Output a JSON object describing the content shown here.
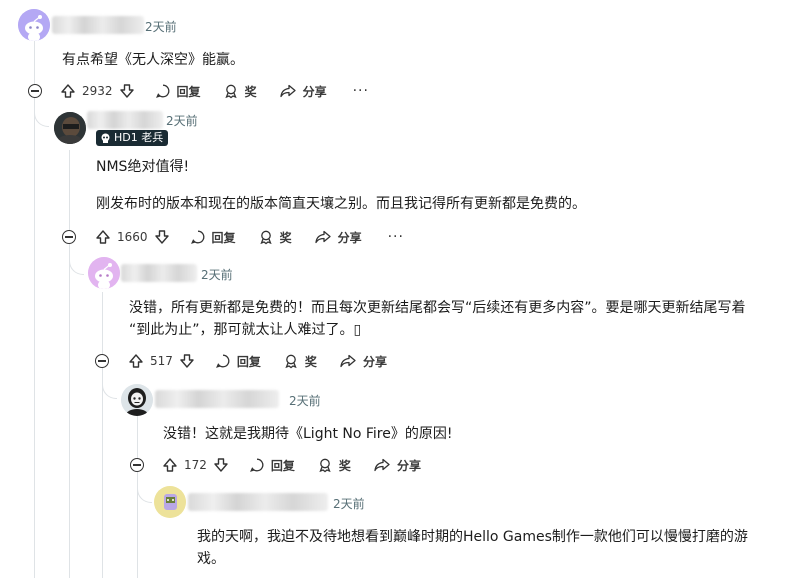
{
  "comments": [
    {
      "time": "2天前",
      "text": "有点希望《无人深空》能赢。",
      "votes": "2932",
      "reply_label": "回复",
      "award_label": "奖",
      "share_label": "分享",
      "more_label": "···"
    },
    {
      "time": "2天前",
      "badge": "HD1 老兵",
      "text_line1": "NMS绝对值得!",
      "text_line2": "刚发布时的版本和现在的版本简直天壤之别。而且我记得所有更新都是免费的。",
      "votes": "1660",
      "reply_label": "回复",
      "award_label": "奖",
      "share_label": "分享",
      "more_label": "···"
    },
    {
      "time": "2天前",
      "text_line1": "没错，所有更新都是免费的！而且每次更新结尾都会写“后续还有更多内容”。要是哪天更新结尾写着",
      "text_line2": "“到此为止”，那可就太让人难过了。▯",
      "votes": "517",
      "reply_label": "回复",
      "award_label": "奖",
      "share_label": "分享"
    },
    {
      "time": "2天前",
      "text": "没错！这就是我期待《Light No Fire》的原因!",
      "votes": "172",
      "reply_label": "回复",
      "award_label": "奖",
      "share_label": "分享"
    },
    {
      "time": "2天前",
      "text_line1": "我的天啊，我迫不及待地想看到巅峰时期的Hello Games制作一款他们可以慢慢打磨的游",
      "text_line2": "戏。"
    }
  ],
  "colors": {
    "thread_line": "#dfe3e6",
    "meta_text": "#576f76",
    "badge_bg": "#1a2b33"
  },
  "icons": [
    "upvote-icon",
    "downvote-icon",
    "comment-icon",
    "award-icon",
    "share-icon",
    "collapse-icon",
    "skull-icon"
  ]
}
